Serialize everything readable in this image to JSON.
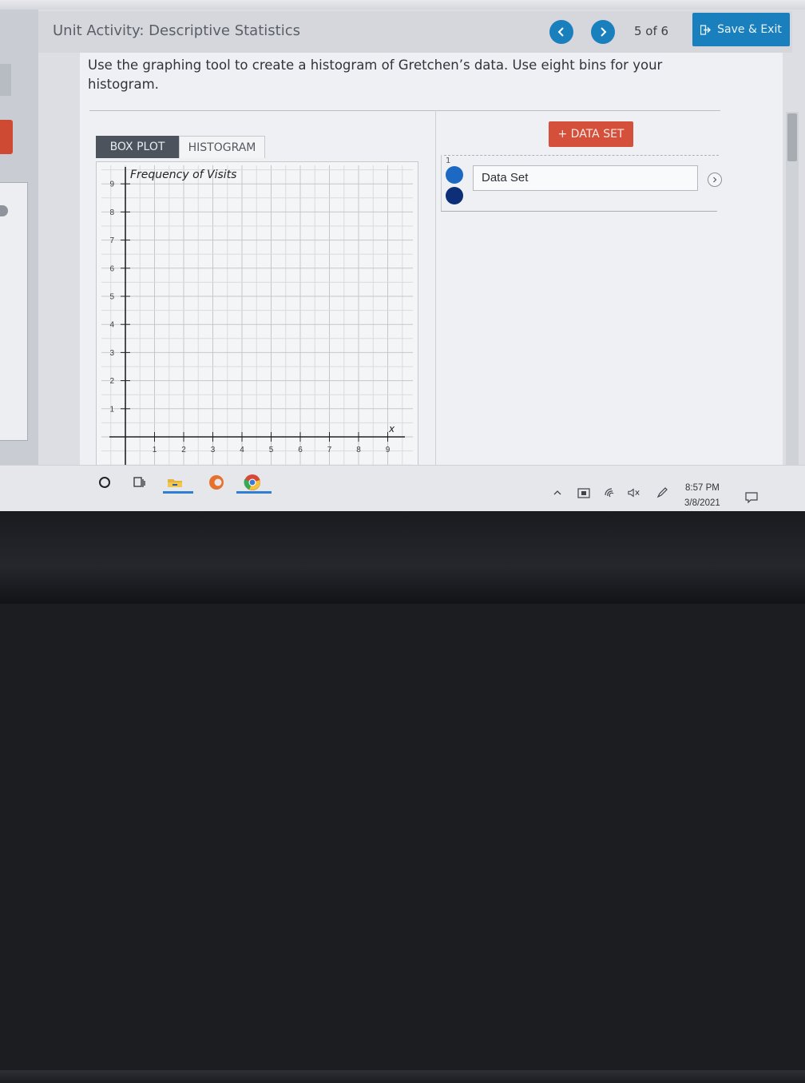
{
  "header": {
    "title": "Unit Activity: Descriptive Statistics",
    "pager": "5 of 6",
    "save_exit_label": "Save & Exit",
    "accent_color": "#1a7fbd"
  },
  "question": {
    "text": "Use the graphing tool to create a histogram of Gretchen’s data. Use eight bins for your histogram."
  },
  "tabs": [
    {
      "label": "BOX PLOT",
      "active": false
    },
    {
      "label": "HISTOGRAM",
      "active": true
    }
  ],
  "chart_data": {
    "type": "bar",
    "title": "",
    "ylabel": "Frequency of Visits",
    "xlabel": "x",
    "xlim": [
      0,
      9
    ],
    "ylim": [
      0,
      9
    ],
    "x_ticks": [
      "1",
      "2",
      "3",
      "4",
      "5",
      "6",
      "7",
      "8",
      "9"
    ],
    "y_ticks": [
      "1",
      "2",
      "3",
      "4",
      "5",
      "6",
      "7",
      "8",
      "9"
    ],
    "values": [],
    "grid": true
  },
  "datasets_panel": {
    "add_button_label": "+ DATA SET",
    "add_button_color": "#d4503a",
    "rows": [
      {
        "number": "1",
        "name": "Data Set",
        "colors": [
          "#1b69c2",
          "#0d2f77"
        ]
      }
    ]
  },
  "taskbar": {
    "time": "8:57 PM",
    "date": "3/8/2021",
    "icons": [
      "cortana-icon",
      "task-view-icon",
      "file-explorer-icon",
      "edge-icon",
      "chrome-icon"
    ],
    "tray_icons": [
      "chevron-up-icon",
      "store-icon",
      "wifi-icon",
      "volume-muted-icon",
      "pen-icon",
      "notification-icon"
    ]
  }
}
